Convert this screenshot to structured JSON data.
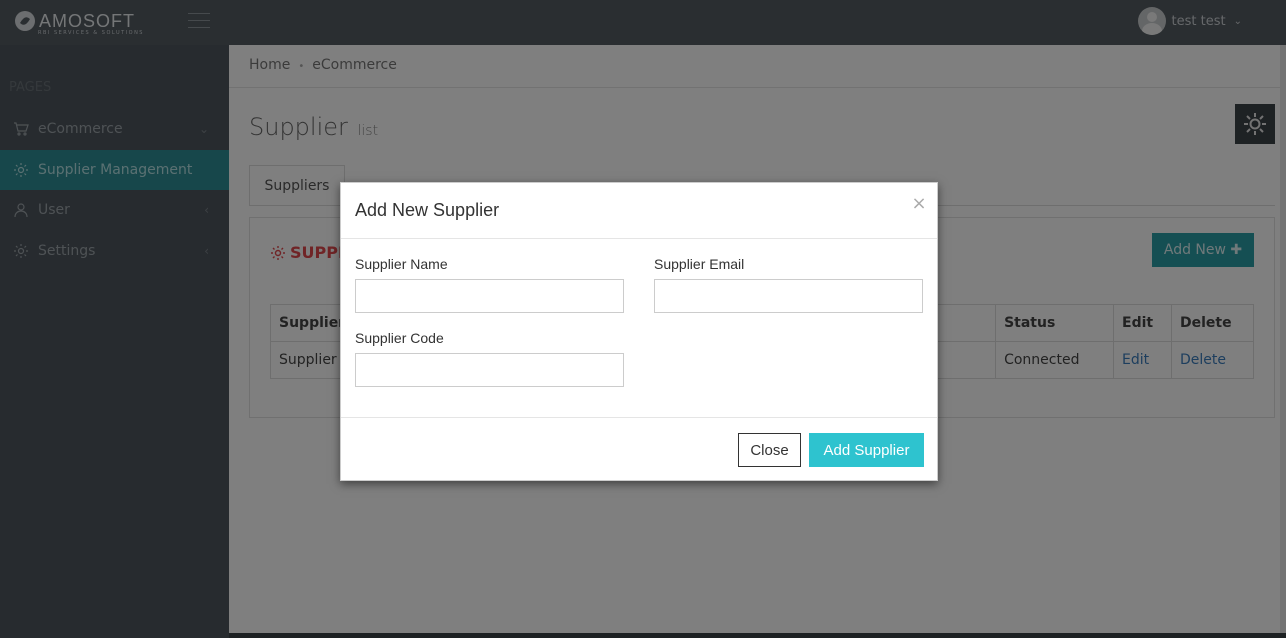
{
  "brand": {
    "name": "AMOSOFT",
    "tagline": "RBI SERVICES & SOLUTIONS"
  },
  "user": {
    "name": "test test"
  },
  "sidebar": {
    "heading": "PAGES",
    "items": [
      {
        "label": "eCommerce",
        "icon": "cart-icon",
        "chevron": "⌄"
      },
      {
        "label": "Supplier Management",
        "icon": "gear-icon",
        "active": true
      },
      {
        "label": "User",
        "icon": "user-icon",
        "chevron": "‹"
      },
      {
        "label": "Settings",
        "icon": "gear-icon",
        "chevron": "‹"
      }
    ]
  },
  "breadcrumb": {
    "items": [
      "Home",
      "eCommerce"
    ],
    "separator": "•"
  },
  "page": {
    "title": "Supplier",
    "subtitle": "list"
  },
  "tabs": [
    {
      "label": "Suppliers"
    }
  ],
  "panel": {
    "title": "SUPPL",
    "add_new_label": "Add New",
    "add_new_icon": "✚",
    "table": {
      "headers": [
        "Supplier",
        "Status",
        "Edit",
        "Delete"
      ],
      "rows": [
        {
          "supplier": "Supplier",
          "status": "Connected",
          "edit": "Edit",
          "delete": "Delete"
        }
      ]
    }
  },
  "modal": {
    "title": "Add New Supplier",
    "close_glyph": "×",
    "fields": {
      "name": {
        "label": "Supplier Name",
        "value": "",
        "placeholder": ""
      },
      "email": {
        "label": "Supplier Email",
        "value": "",
        "placeholder": ""
      },
      "code": {
        "label": "Supplier Code",
        "value": "",
        "placeholder": ""
      }
    },
    "close_label": "Close",
    "submit_label": "Add Supplier"
  },
  "colors": {
    "accent": "#2ec3cf",
    "sidebar_active": "#2f8f96",
    "danger": "#e0484c",
    "topbar": "#545c63"
  }
}
